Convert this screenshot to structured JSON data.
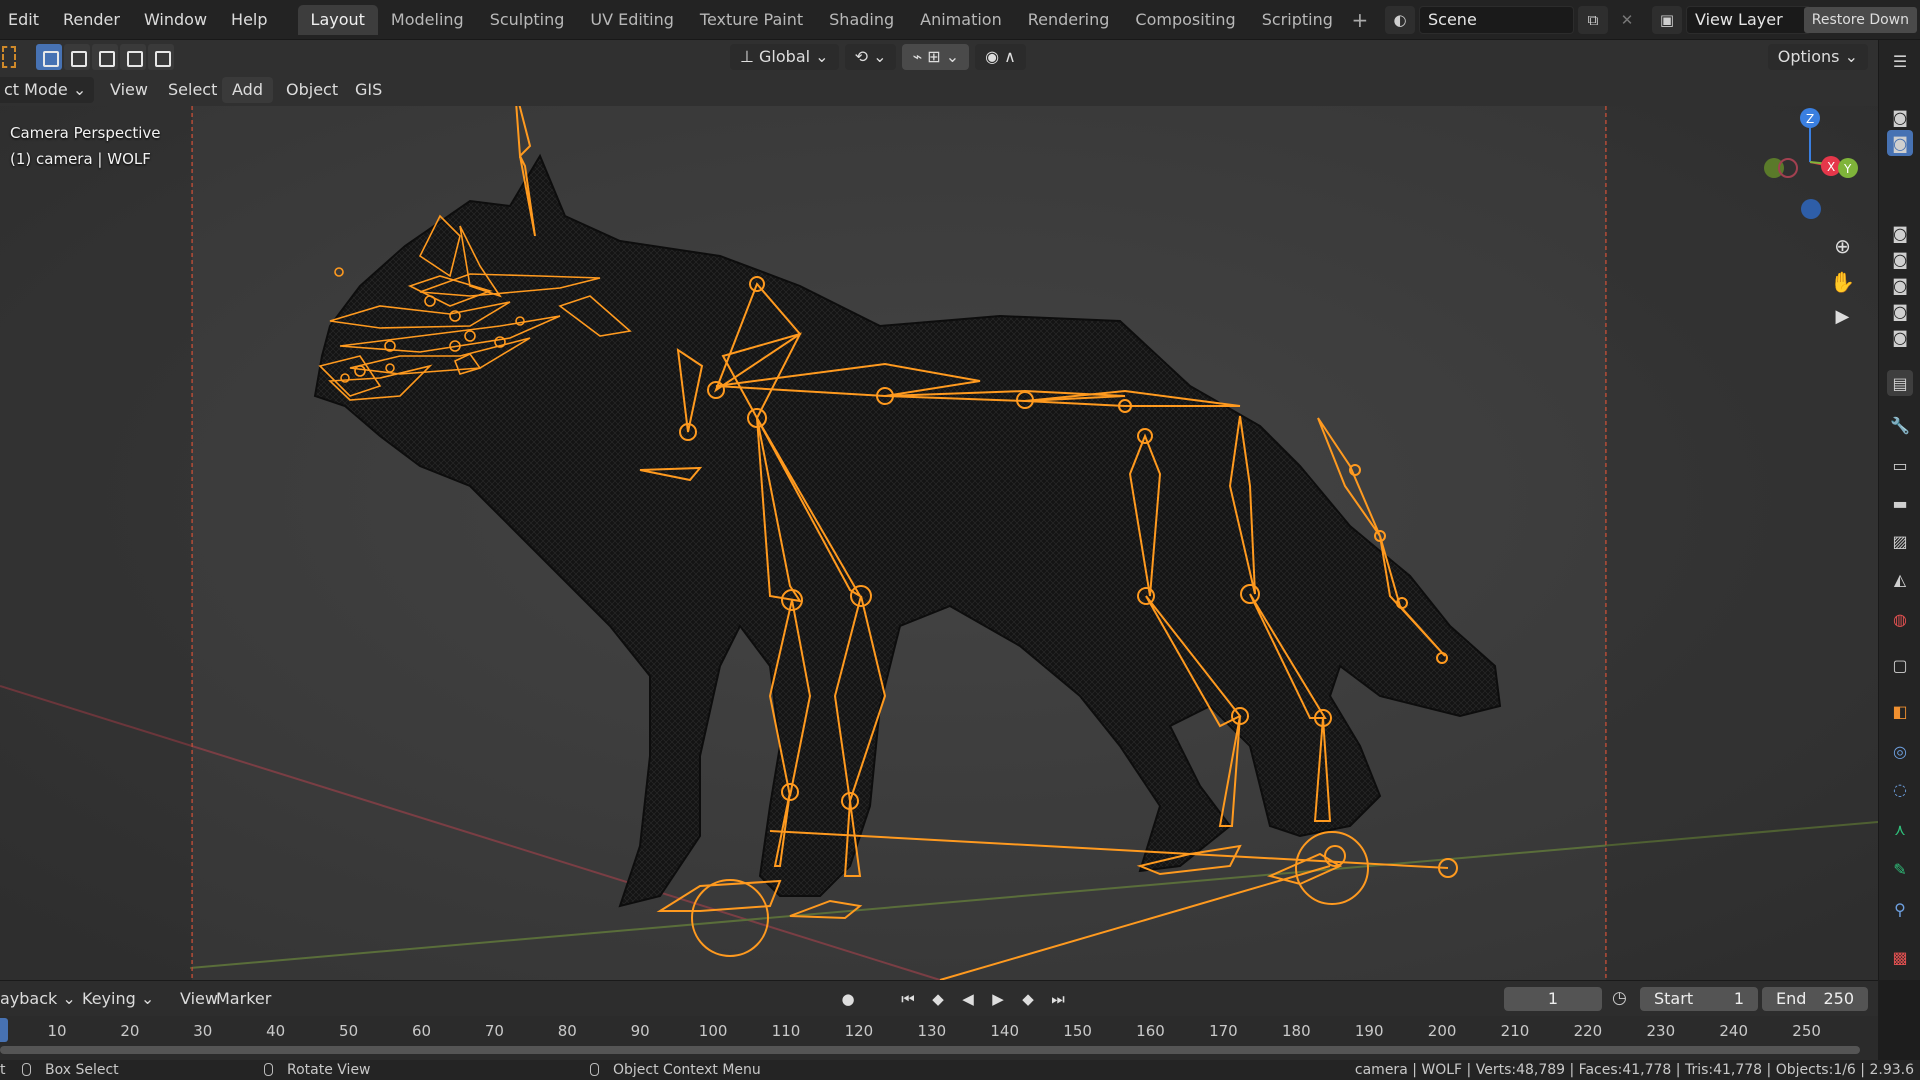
{
  "topbar": {
    "menus": [
      "Edit",
      "Render",
      "Window",
      "Help"
    ],
    "workspaces": [
      "Layout",
      "Modeling",
      "Sculpting",
      "UV Editing",
      "Texture Paint",
      "Shading",
      "Animation",
      "Rendering",
      "Compositing",
      "Scripting"
    ],
    "active_workspace": "Layout",
    "scene_name": "Scene",
    "view_layer": "View Layer",
    "restore_label": "Restore Down"
  },
  "viewport_header": {
    "mode": "ct Mode",
    "menus": [
      "View",
      "Select",
      "Add",
      "Object",
      "GIS"
    ],
    "orientation": "Global",
    "options": "Options"
  },
  "viewport": {
    "perspective": "Camera Perspective",
    "object_info": "(1) camera | WOLF",
    "gizmo": {
      "z": "Z",
      "x": "X",
      "y": "Y"
    }
  },
  "timeline": {
    "menus": [
      "ayback",
      "Keying",
      "View",
      "Marker"
    ],
    "current_frame": "1",
    "start_label": "Start",
    "start": "1",
    "end_label": "End",
    "end": "250",
    "ticks": [
      "10",
      "20",
      "30",
      "40",
      "50",
      "60",
      "70",
      "80",
      "90",
      "100",
      "110",
      "120",
      "130",
      "140",
      "150",
      "160",
      "170",
      "180",
      "190",
      "200",
      "210",
      "220",
      "230",
      "240",
      "250"
    ]
  },
  "statusbar": {
    "left_fragment": "t",
    "box_select": "Box Select",
    "rotate_view": "Rotate View",
    "context_menu": "Object Context Menu",
    "stats": "camera | WOLF | Verts:48,789 | Faces:41,778 | Tris:41,778 | Objects:1/6 | 2.93.6"
  },
  "colors": {
    "bone": "#ff9a1f",
    "viewport_bg": "#3c3c3c",
    "accent_blue": "#4772b3",
    "axis_x": "#e5374a",
    "axis_y": "#7fb43a",
    "axis_z": "#3a7fe0"
  }
}
